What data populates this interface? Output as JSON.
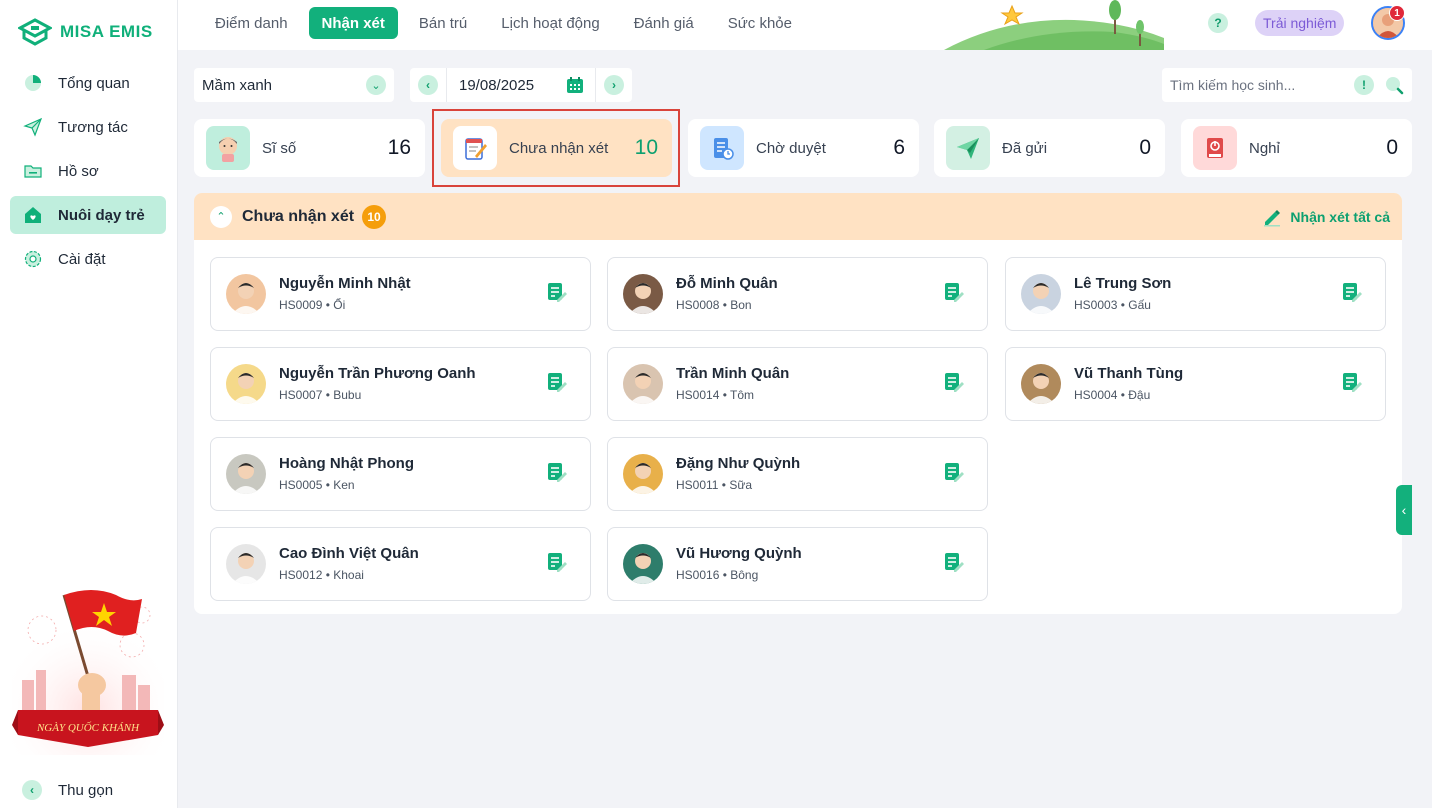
{
  "app": {
    "logo_text": "MISA EMIS"
  },
  "sidebar": {
    "items": [
      {
        "label": "Tổng quan",
        "icon": "pie-chart-icon",
        "active": false
      },
      {
        "label": "Tương tác",
        "icon": "paper-plane-icon",
        "active": false
      },
      {
        "label": "Hồ sơ",
        "icon": "folder-icon",
        "active": false
      },
      {
        "label": "Nuôi dạy trẻ",
        "icon": "house-heart-icon",
        "active": true
      },
      {
        "label": "Cài đặt",
        "icon": "gear-icon",
        "active": false
      }
    ],
    "banner_text": "NGÀY QUỐC KHÁNH",
    "collapse_label": "Thu gọn"
  },
  "topbar": {
    "tabs": [
      {
        "label": "Điểm danh",
        "active": false
      },
      {
        "label": "Nhận xét",
        "active": true
      },
      {
        "label": "Bán trú",
        "active": false
      },
      {
        "label": "Lịch hoạt động",
        "active": false
      },
      {
        "label": "Đánh giá",
        "active": false
      },
      {
        "label": "Sức khỏe",
        "active": false
      }
    ],
    "help_label": "?",
    "trial_label": "Trải nghiệm",
    "notification_count": "1"
  },
  "filters": {
    "class_value": "Mầm xanh",
    "date_value": "19/08/2025",
    "search_placeholder": "Tìm kiếm học sinh...",
    "search_info": "!"
  },
  "stats": [
    {
      "label": "Sĩ số",
      "value": "16",
      "icon": "class-student-icon",
      "icon_bg": "#bfeedd"
    },
    {
      "label": "Chưa nhận xét",
      "value": "10",
      "icon": "notepad-pen-icon",
      "icon_bg": "#ffffff",
      "selected": true
    },
    {
      "label": "Chờ duyệt",
      "value": "6",
      "icon": "document-clock-icon",
      "icon_bg": "#cfe6ff"
    },
    {
      "label": "Đã gửi",
      "value": "0",
      "icon": "paper-plane-icon",
      "icon_bg": "#d3f0e3"
    },
    {
      "label": "Nghỉ",
      "value": "0",
      "icon": "power-book-icon",
      "icon_bg": "#ffd9d9"
    }
  ],
  "panel": {
    "title": "Chưa nhận xét",
    "count": "10",
    "comment_all_label": "Nhận xét tất cả"
  },
  "students": [
    {
      "name": "Nguyễn Minh Nhật",
      "code": "HS0009 • Ổi",
      "avatar_color": "#f2c6a0"
    },
    {
      "name": "Đỗ Minh Quân",
      "code": "HS0008 • Bon",
      "avatar_color": "#7a5a45"
    },
    {
      "name": "Lê Trung Sơn",
      "code": "HS0003 • Gấu",
      "avatar_color": "#c9d3e0"
    },
    {
      "name": "Nguyễn Trần Phương Oanh",
      "code": "HS0007 • Bubu",
      "avatar_color": "#f5d98a"
    },
    {
      "name": "Trần Minh Quân",
      "code": "HS0014 • Tôm",
      "avatar_color": "#d9c4b0"
    },
    {
      "name": "Vũ Thanh Tùng",
      "code": "HS0004 • Đậu",
      "avatar_color": "#b08a5c"
    },
    {
      "name": "Hoàng Nhật Phong",
      "code": "HS0005 • Ken",
      "avatar_color": "#c8c8c0"
    },
    {
      "name": "Đặng Như Quỳnh",
      "code": "HS0011 • Sữa",
      "avatar_color": "#e8b04a"
    },
    {
      "name": "Cao Đình Việt Quân",
      "code": "HS0012 • Khoai",
      "avatar_color": "#e6e6e6"
    },
    {
      "name": "Vũ Hương Quỳnh",
      "code": "HS0016 • Bông",
      "avatar_color": "#2e7d6b"
    }
  ],
  "colors": {
    "accent": "#12b07c",
    "selected_card": "#ffe2c3",
    "badge": "#f59e0b"
  }
}
